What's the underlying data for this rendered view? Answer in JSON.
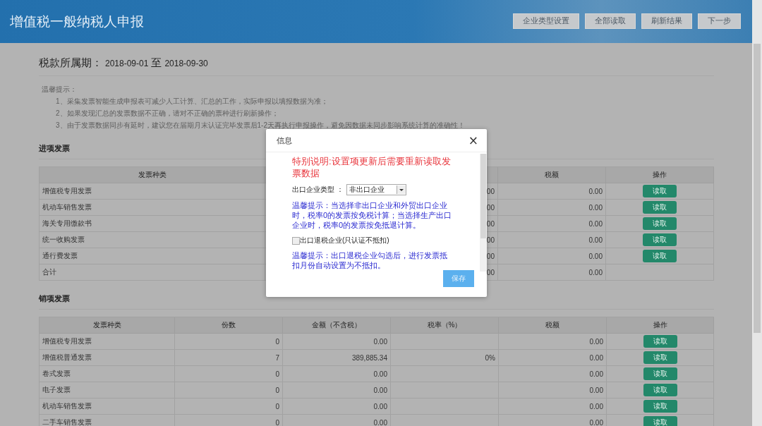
{
  "header": {
    "title": "增值税一般纳税人申报",
    "buttons": [
      "企业类型设置",
      "全部读取",
      "刷新结果",
      "下一步"
    ]
  },
  "period": {
    "label": "税款所属期：",
    "start": "2018-09-01",
    "separator": "至",
    "end": "2018-09-30"
  },
  "tips": {
    "title": "温馨提示：",
    "items": [
      "1、采集发票智能生成申报表可减少人工计算、汇总的工作，实际申报以填报数据为准；",
      "2、如果发现汇总的发票数据不正确，请对不正确的票种进行刷新操作；",
      "3、由于发票数据同步有延时，建议您在届期月末认证完毕发票后1-2天再执行申报操作，避免因数据未同步影响系统计算的准确性！"
    ]
  },
  "input_invoices": {
    "title": "进项发票",
    "columns": [
      "发票种类",
      "税额",
      "操作"
    ],
    "rows": [
      {
        "kind": "增值税专用发票",
        "column_2": ".00",
        "tax": "0.00",
        "action": "读取"
      },
      {
        "kind": "机动车销售发票",
        "column_2": ".00",
        "tax": "0.00",
        "action": "读取"
      },
      {
        "kind": "海关专用缴款书",
        "column_2": ".00",
        "tax": "0.00",
        "action": "读取"
      },
      {
        "kind": "统一收购发票",
        "column_2": ".00",
        "tax": "0.00",
        "action": "读取"
      },
      {
        "kind": "通行费发票",
        "column_2": ".00",
        "tax": "0.00",
        "action": "读取"
      },
      {
        "kind": "合计",
        "column_2": ".00",
        "tax": "0.00"
      }
    ]
  },
  "output_invoices": {
    "title": "销项发票",
    "columns": [
      "发票种类",
      "份数",
      "金额（不含税）",
      "税率（%）",
      "税额",
      "操作"
    ],
    "rows": [
      {
        "kind": "增值税专用发票",
        "count": "0",
        "amount": "0.00",
        "tax": "0.00",
        "action": "读取"
      },
      {
        "kind": "增值税普通发票",
        "count": "7",
        "amount": "389,885.34",
        "rate": "0%",
        "tax": "0.00",
        "action": "读取"
      },
      {
        "kind": "卷式发票",
        "count": "0",
        "amount": "0.00",
        "tax": "0.00",
        "action": "读取"
      },
      {
        "kind": "电子发票",
        "count": "0",
        "amount": "0.00",
        "tax": "0.00",
        "action": "读取"
      },
      {
        "kind": "机动车销售发票",
        "count": "0",
        "amount": "0.00",
        "tax": "0.00",
        "action": "读取"
      },
      {
        "kind": "二手车销售发票",
        "count": "0",
        "amount": "0.00",
        "tax": "0.00",
        "action": "读取"
      }
    ]
  },
  "dialog": {
    "title": "信息",
    "close": "×",
    "notice": "特别说明:设置项更新后需要重新读取发票数据",
    "field_label": "出口企业类型 ：",
    "select_value": "非出口企业",
    "hint_1": "温馨提示：当选择非出口企业和外贸出口企业时，税率0的发票按免税计算；当选择生产出口企业时，税率0的发票按免抵退计算。",
    "checkbox": {
      "label": "出口退税企业(只认证不抵扣)",
      "checked": false
    },
    "hint_2": "温馨提示：出口退税企业勾选后，进行发票抵扣月份自动设置为不抵扣。",
    "save": "保存"
  }
}
